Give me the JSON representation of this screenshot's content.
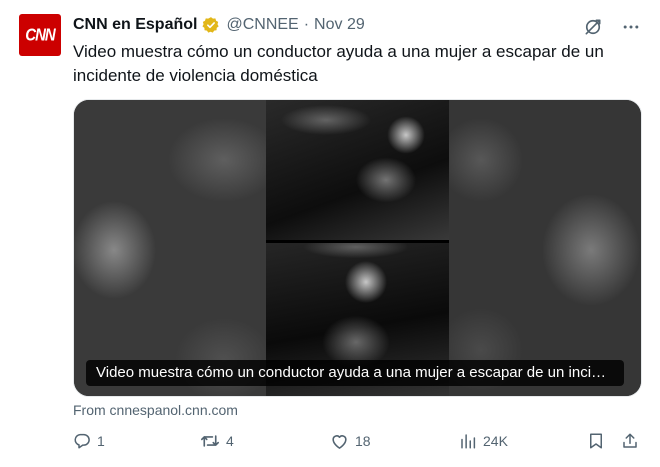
{
  "author": {
    "avatar_text": "CNN",
    "name": "CNN en Español",
    "handle": "@CNNEE",
    "separator": "·",
    "time": "Nov 29"
  },
  "tweet": {
    "text": "Video muestra cómo un conductor ayuda a una mujer a escapar de un incidente de violencia doméstica",
    "media_caption": "Video muestra cómo un conductor ayuda a una mujer a escapar de un incidente de violencia doméstica",
    "source": "From cnnespanol.cnn.com"
  },
  "actions": {
    "replies": "1",
    "retweets": "4",
    "likes": "18",
    "views": "24K"
  },
  "icons": {
    "verified": "verified-badge-icon",
    "grok": "grok-icon",
    "more": "more-dots-icon",
    "reply": "reply-icon",
    "retweet": "retweet-icon",
    "like": "heart-icon",
    "views": "views-chart-icon",
    "bookmark": "bookmark-icon",
    "share": "share-icon"
  },
  "colors": {
    "avatar_bg": "#cc0000",
    "verified_gold": "#e2b719",
    "secondary_text": "#536471"
  }
}
